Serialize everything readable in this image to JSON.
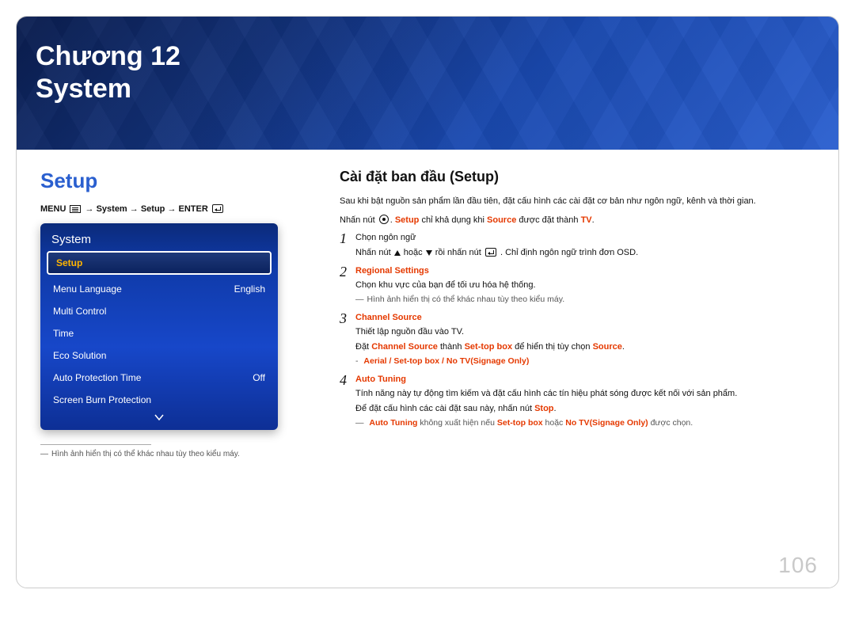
{
  "chapter": {
    "line1": "Chương 12",
    "line2": "System"
  },
  "left": {
    "setup_heading": "Setup",
    "menu_path": {
      "menu": "MENU",
      "sep": " → ",
      "p1": "System",
      "p2": "Setup",
      "enter": "ENTER"
    },
    "osd": {
      "title": "System",
      "selected": "Setup",
      "rows": [
        {
          "label": "Menu Language",
          "value": "English"
        },
        {
          "label": "Multi Control",
          "value": ""
        },
        {
          "label": "Time",
          "value": ""
        },
        {
          "label": "Eco Solution",
          "value": ""
        },
        {
          "label": "Auto Protection Time",
          "value": "Off"
        },
        {
          "label": "Screen Burn Protection",
          "value": ""
        }
      ]
    },
    "footnote": "Hình ảnh hiển thị có thể khác nhau tùy theo kiểu máy."
  },
  "right": {
    "heading": "Cài đặt ban đầu (Setup)",
    "intro": "Sau khi bật nguồn sản phẩm lần đầu tiên, đặt cấu hình các cài đặt cơ bản như ngôn ngữ, kênh và thời gian.",
    "press_prefix": "Nhấn nút ",
    "setup_word": "Setup",
    "only_text": " chỉ khả dụng khi ",
    "source_word": "Source",
    "set_to": " được đặt thành ",
    "tv_word": "TV",
    "step1": {
      "num": "1",
      "title": "Chọn ngôn ngữ",
      "detail_pre": "Nhấn nút ",
      "detail_mid1": " hoặc ",
      "detail_mid2": " rồi nhấn nút ",
      "detail_post": ". Chỉ định ngôn ngữ trình đơn OSD."
    },
    "step2": {
      "num": "2",
      "title": "Regional Settings",
      "detail": "Chọn khu vực của bạn để tối ưu hóa hệ thống.",
      "note": "Hình ảnh hiển thị có thể khác nhau tùy theo kiểu máy."
    },
    "step3": {
      "num": "3",
      "title": "Channel Source",
      "detail": "Thiết lập nguồn đầu vào TV.",
      "set_pre": "Đặt ",
      "cs": "Channel Source",
      "set_mid": " thành ",
      "stb": "Set-top box",
      "set_post": " để hiển thị tùy chọn ",
      "src": "Source",
      "opts_pre": "Aerial",
      "opts_sep": " / ",
      "opt2": "Set-top box",
      "opt3": "No TV(Signage Only)"
    },
    "step4": {
      "num": "4",
      "title": "Auto Tuning",
      "d1": "Tính năng này tự động tìm kiếm và đặt cấu hình các tín hiệu phát sóng được kết nối với sản phẩm.",
      "d2_pre": "Để đặt cấu hình các cài đặt sau này, nhấn nút ",
      "stop": "Stop",
      "note_pre": "Auto Tuning",
      "note_mid1": " không xuất hiện nếu ",
      "note_stb": "Set-top box",
      "note_mid2": " hoặc ",
      "note_no": "No TV(Signage Only)",
      "note_post": " được chọn."
    }
  },
  "page_number": "106"
}
